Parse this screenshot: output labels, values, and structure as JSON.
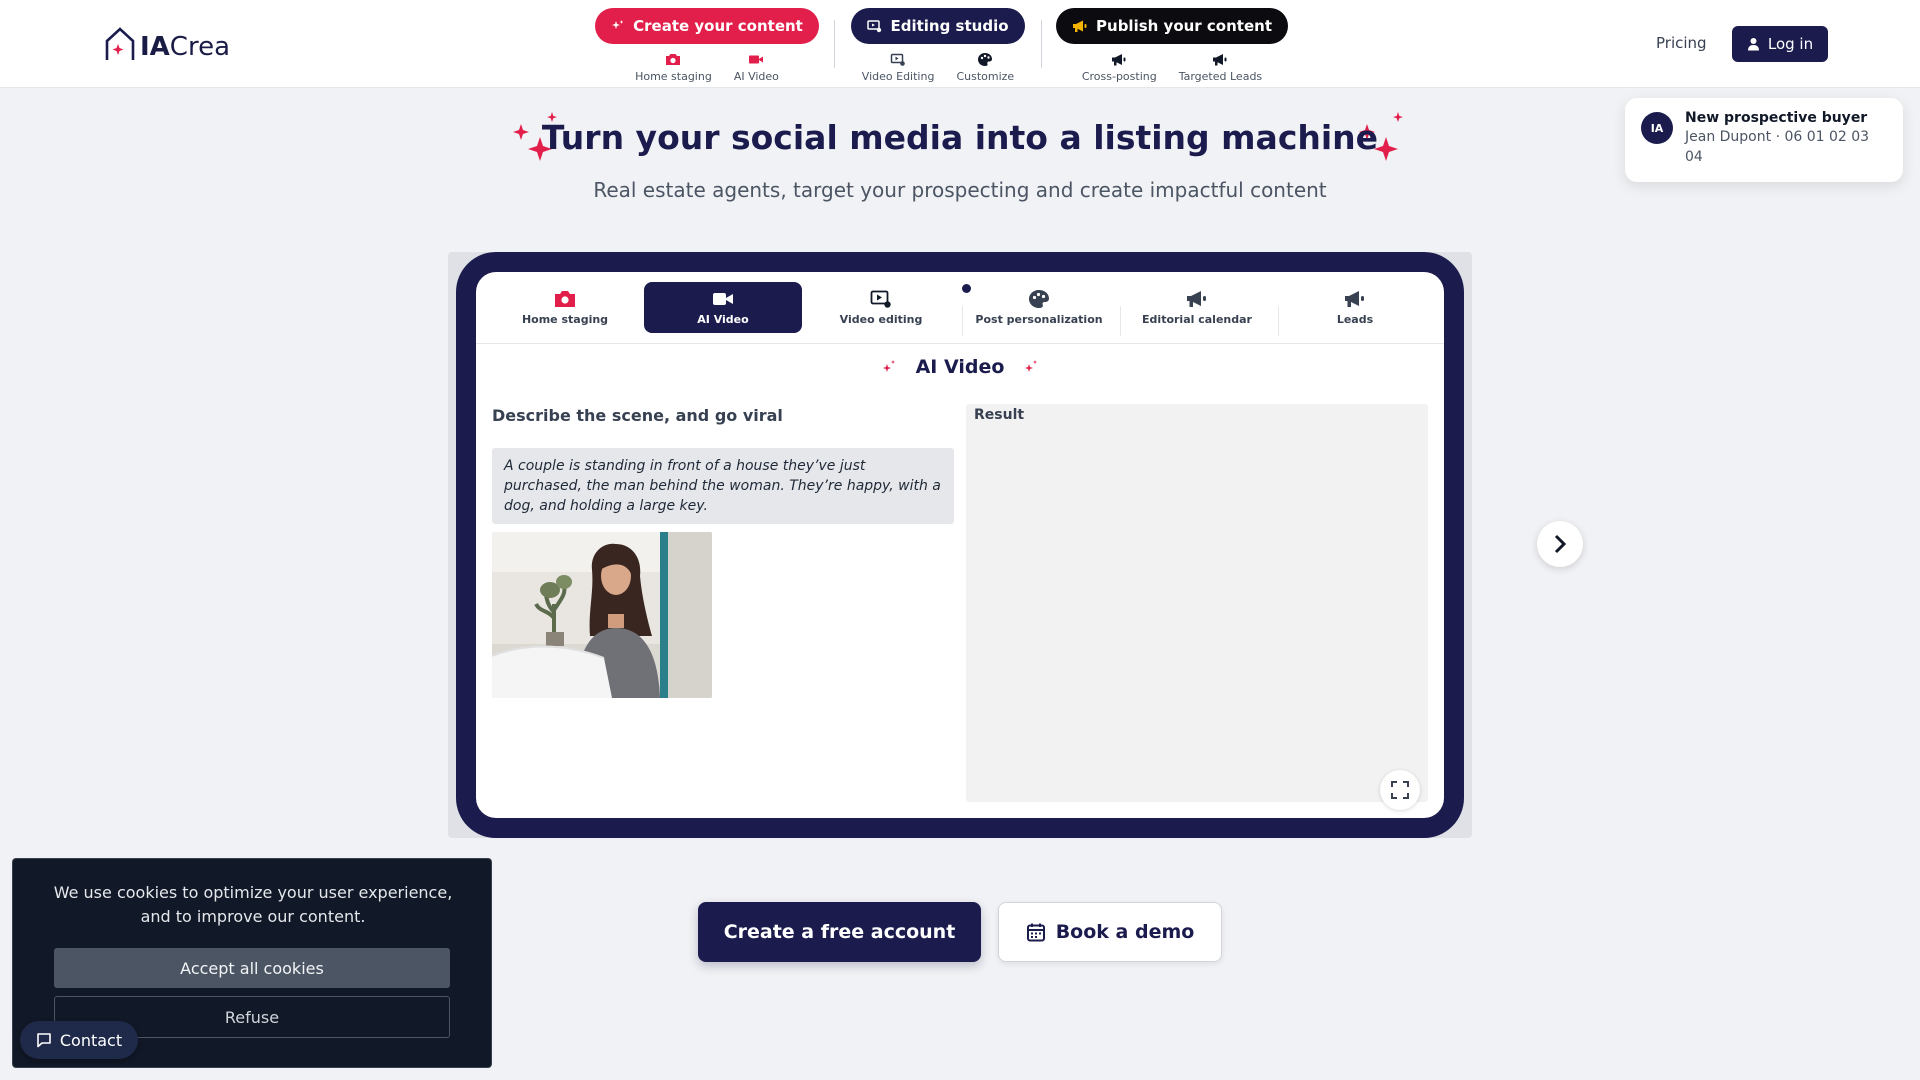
{
  "header": {
    "logo": {
      "prefix": "IA",
      "suffix": "Crea"
    },
    "nav": [
      {
        "label": "Create your content",
        "subs": [
          "Home staging",
          "AI Video"
        ]
      },
      {
        "label": "Editing studio",
        "subs": [
          "Video Editing",
          "Customize"
        ]
      },
      {
        "label": "Publish your content",
        "subs": [
          "Cross-posting",
          "Targeted Leads"
        ]
      }
    ],
    "pricing": "Pricing",
    "login": "Log in"
  },
  "hero": {
    "title": "Turn your social media into a listing machine",
    "subtitle": "Real estate agents, target your prospecting and create impactful content"
  },
  "notification": {
    "avatar": "IA",
    "title": "New prospective buyer",
    "body": "Jean Dupont · 06 01 02 03 04"
  },
  "demo": {
    "tabs": [
      {
        "label": "Home staging",
        "icon": "camera-icon"
      },
      {
        "label": "AI Video",
        "icon": "video-camera-icon"
      },
      {
        "label": "Video editing",
        "icon": "video-edit-icon"
      },
      {
        "label": "Post personalization",
        "icon": "palette-icon"
      },
      {
        "label": "Editorial calendar",
        "icon": "megaphone-icon"
      },
      {
        "label": "Leads",
        "icon": "megaphone-icon"
      }
    ],
    "active_tab": "AI Video",
    "title": "AI Video",
    "left_heading": "Describe the scene, and go viral",
    "prompt": "A couple is standing in front of a house they’ve just purchased, the man behind the woman. They’re happy, with a dog, and holding a large key.",
    "result_label": "Result"
  },
  "cta": {
    "primary": "Create a free account",
    "secondary": "Book a demo"
  },
  "cookie": {
    "text": "We use cookies to optimize your user experience, and to improve our content.",
    "accept": "Accept all cookies",
    "refuse": "Refuse"
  },
  "contact": "Contact",
  "colors": {
    "accent": "#e21f4a",
    "navy": "#1b1c4d",
    "black": "#0c0c10"
  }
}
